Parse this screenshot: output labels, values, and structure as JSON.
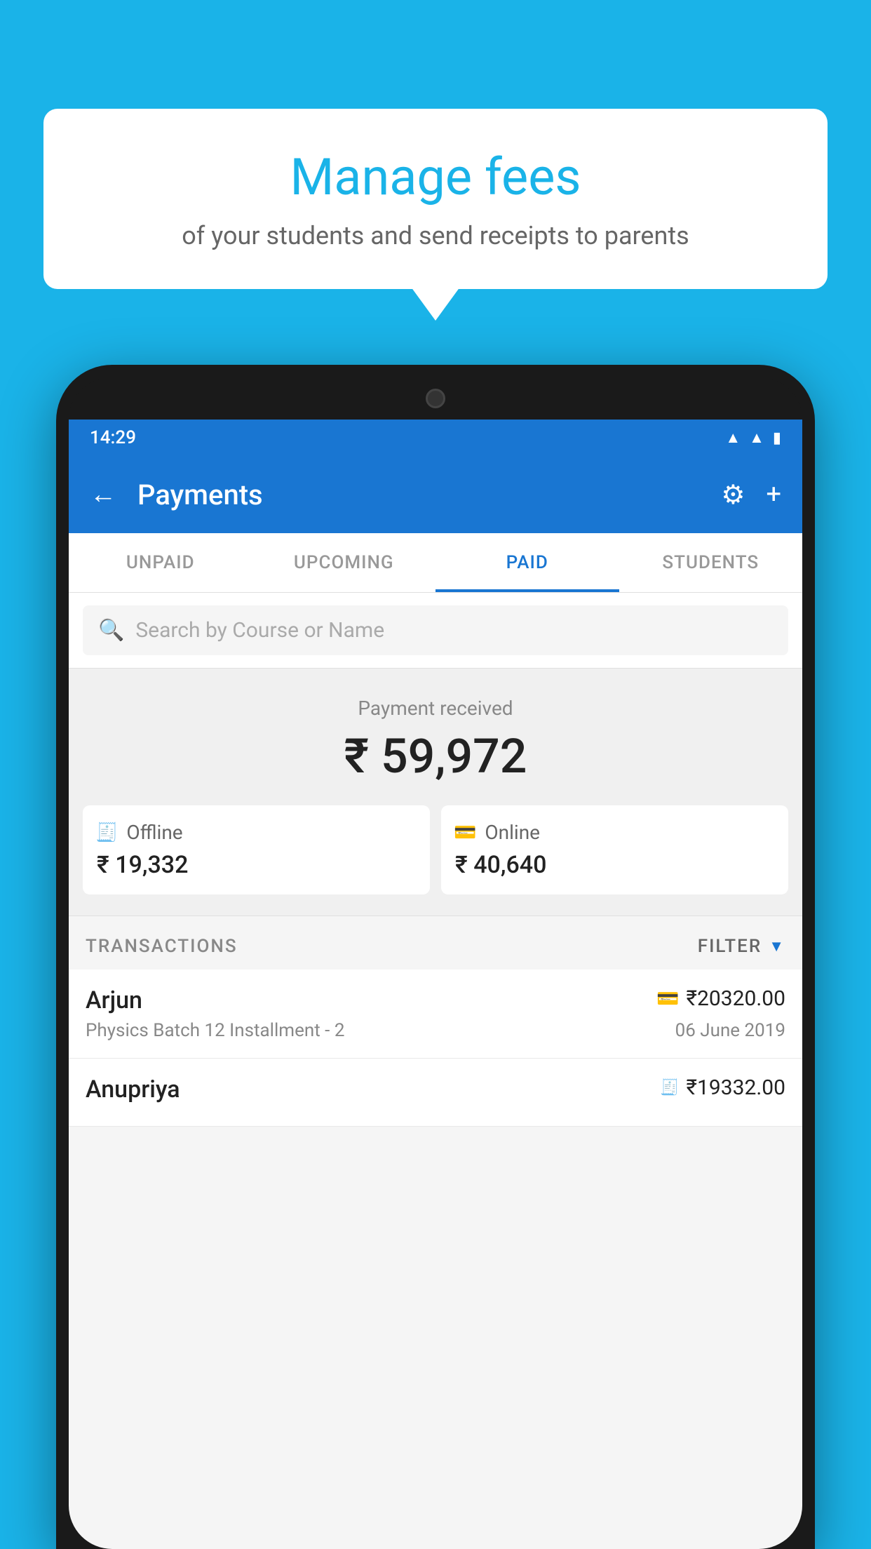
{
  "background_color": "#1ab3e8",
  "bubble": {
    "title": "Manage fees",
    "subtitle": "of your students and send receipts to parents"
  },
  "status_bar": {
    "time": "14:29",
    "icons": [
      "wifi",
      "signal",
      "battery"
    ]
  },
  "app_bar": {
    "title": "Payments",
    "back_label": "←",
    "gear_label": "⚙",
    "plus_label": "+"
  },
  "tabs": [
    {
      "label": "UNPAID",
      "active": false
    },
    {
      "label": "UPCOMING",
      "active": false
    },
    {
      "label": "PAID",
      "active": true
    },
    {
      "label": "STUDENTS",
      "active": false
    }
  ],
  "search": {
    "placeholder": "Search by Course or Name"
  },
  "payment_summary": {
    "label": "Payment received",
    "amount": "₹ 59,972",
    "offline_label": "Offline",
    "offline_amount": "₹ 19,332",
    "online_label": "Online",
    "online_amount": "₹ 40,640"
  },
  "transactions": {
    "section_label": "TRANSACTIONS",
    "filter_label": "FILTER",
    "items": [
      {
        "name": "Arjun",
        "amount": "₹20320.00",
        "course": "Physics Batch 12 Installment - 2",
        "date": "06 June 2019",
        "payment_type": "card"
      },
      {
        "name": "Anupriya",
        "amount": "₹19332.00",
        "course": "",
        "date": "",
        "payment_type": "rupee"
      }
    ]
  }
}
